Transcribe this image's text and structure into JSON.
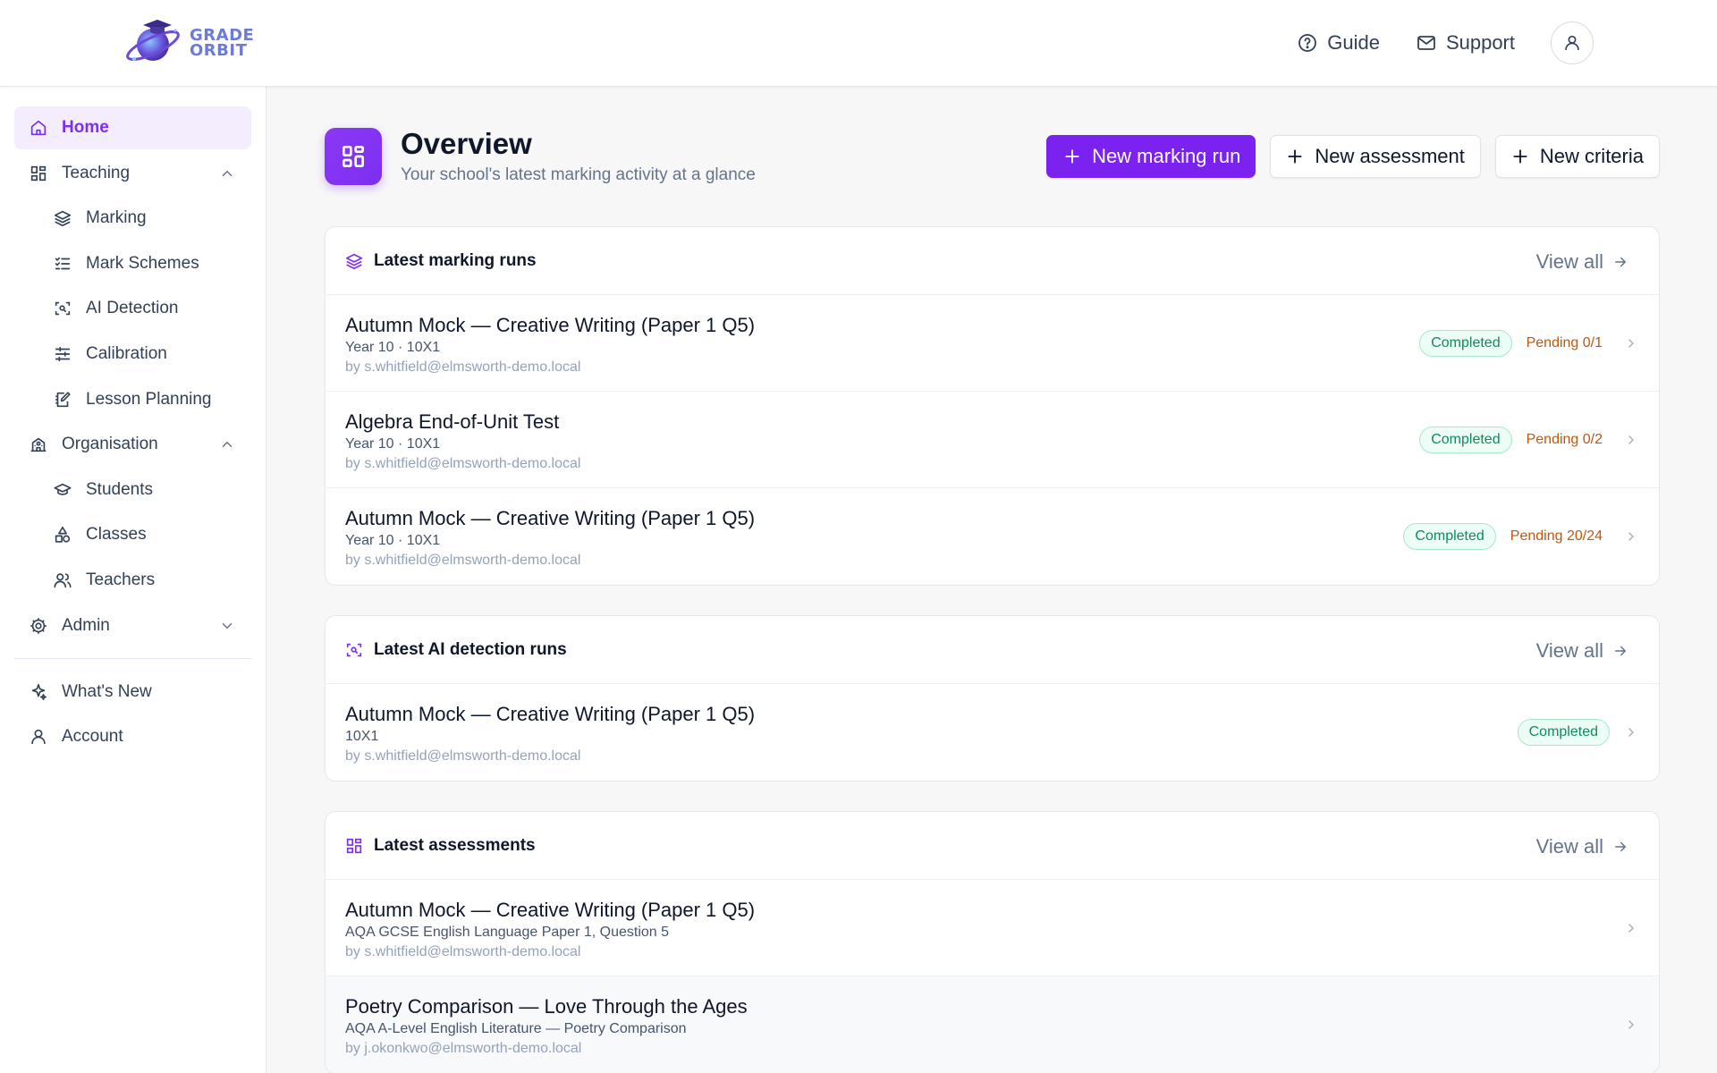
{
  "brand": {
    "line1": "GRADE",
    "line2": "ORBIT"
  },
  "topnav": {
    "guide": "Guide",
    "support": "Support"
  },
  "sidebar": {
    "items": [
      {
        "label": "Home"
      },
      {
        "label": "Teaching"
      },
      {
        "label": "Marking"
      },
      {
        "label": "Mark Schemes"
      },
      {
        "label": "AI Detection"
      },
      {
        "label": "Calibration"
      },
      {
        "label": "Lesson Planning"
      },
      {
        "label": "Organisation"
      },
      {
        "label": "Students"
      },
      {
        "label": "Classes"
      },
      {
        "label": "Teachers"
      },
      {
        "label": "Admin"
      },
      {
        "label": "What's New"
      },
      {
        "label": "Account"
      }
    ]
  },
  "page": {
    "title": "Overview",
    "subtitle": "Your school's latest marking activity at a glance",
    "actions": {
      "new_marking_run": "New marking run",
      "new_assessment": "New assessment",
      "new_criteria": "New criteria"
    }
  },
  "marking_runs": {
    "title": "Latest marking runs",
    "view_all": "View all",
    "rows": [
      {
        "title": "Autumn Mock — Creative Writing (Paper 1 Q5)",
        "meta": "Year 10 · 10X1",
        "by": "by s.whitfield@elmsworth-demo.local",
        "status": "Completed",
        "pending": "Pending 0/1"
      },
      {
        "title": "Algebra End-of-Unit Test",
        "meta": "Year 10 · 10X1",
        "by": "by s.whitfield@elmsworth-demo.local",
        "status": "Completed",
        "pending": "Pending 0/2"
      },
      {
        "title": "Autumn Mock — Creative Writing (Paper 1 Q5)",
        "meta": "Year 10 · 10X1",
        "by": "by s.whitfield@elmsworth-demo.local",
        "status": "Completed",
        "pending": "Pending 20/24"
      }
    ]
  },
  "ai_detection": {
    "title": "Latest AI detection runs",
    "view_all": "View all",
    "rows": [
      {
        "title": "Autumn Mock — Creative Writing (Paper 1 Q5)",
        "meta": "10X1",
        "by": "by s.whitfield@elmsworth-demo.local",
        "status": "Completed"
      }
    ]
  },
  "assessments": {
    "title": "Latest assessments",
    "view_all": "View all",
    "rows": [
      {
        "title": "Autumn Mock — Creative Writing (Paper 1 Q5)",
        "meta": "AQA GCSE English Language Paper 1, Question 5",
        "by": "by s.whitfield@elmsworth-demo.local"
      },
      {
        "title": "Poetry Comparison — Love Through the Ages",
        "meta": "AQA A-Level English Literature — Poetry Comparison",
        "by": "by j.okonkwo@elmsworth-demo.local"
      }
    ]
  },
  "colors": {
    "accent": "#7c22f0",
    "success": "#0f8a61",
    "warning": "#c2570c"
  }
}
